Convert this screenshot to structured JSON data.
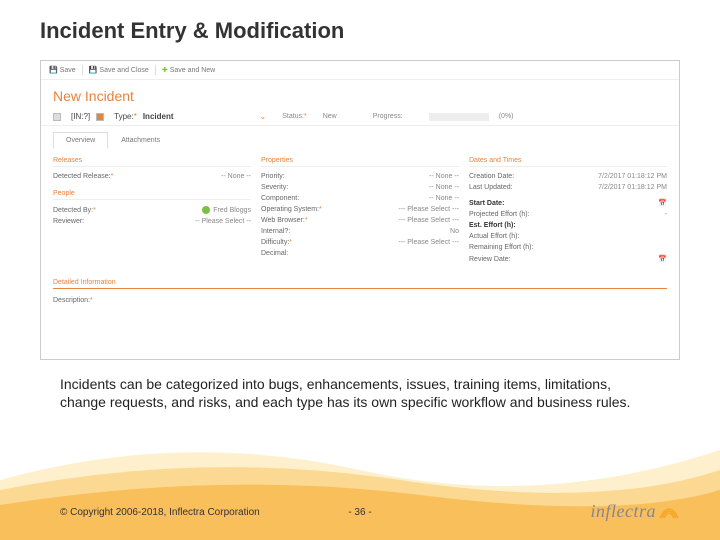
{
  "slide": {
    "title": "Incident Entry & Modification",
    "caption": "Incidents can be categorized into bugs, enhancements, issues, training items, limitations, change requests, and risks, and each type has its own specific workflow and business rules.",
    "copyright": "© Copyright 2006-2018, Inflectra Corporation",
    "page": "- 36 -",
    "logo_text": "inflectra"
  },
  "app": {
    "toolbar": {
      "save": "Save",
      "save_close": "Save and Close",
      "save_new": "Save and New"
    },
    "heading": "New Incident",
    "id_prefix": "[IN:?]",
    "type_label": "Type:",
    "type_value": "Incident",
    "status_label": "Status:",
    "status_value": "New",
    "progress_label": "Progress:",
    "progress_percent": "(0%)",
    "tabs": [
      "Overview",
      "Attachments"
    ],
    "sections": {
      "releases": {
        "title": "Releases",
        "detected_release": "Detected Release:",
        "detected_release_v": "-- None --"
      },
      "people": {
        "title": "People",
        "detected_by": "Detected By:",
        "detected_by_v": "Fred Bloggs",
        "reviewer": "Reviewer:",
        "reviewer_v": "-- Please Select --"
      },
      "properties": {
        "title": "Properties",
        "fields": [
          {
            "k": "Priority:",
            "v": "-- None --"
          },
          {
            "k": "Severity:",
            "v": "-- None --"
          },
          {
            "k": "Component:",
            "v": "-- None --"
          },
          {
            "k": "Operating System:",
            "v": "--- Please Select ---"
          },
          {
            "k": "Web Browser:",
            "v": "--- Please Select ---"
          },
          {
            "k": "Internal?:",
            "v": "No"
          },
          {
            "k": "Difficulty:",
            "v": "--- Please Select ---"
          },
          {
            "k": "Decimal:",
            "v": ""
          }
        ]
      },
      "dates": {
        "title": "Dates and Times",
        "fields": [
          {
            "k": "Creation Date:",
            "v": "7/2/2017 01:18:12 PM"
          },
          {
            "k": "Last Updated:",
            "v": "7/2/2017 01:18:12 PM"
          },
          {
            "k": "Start Date:",
            "v": ""
          },
          {
            "k": "Projected Effort (h):",
            "v": ""
          },
          {
            "k": "Est. Effort (h):",
            "v": ""
          },
          {
            "k": "Actual Effort (h):",
            "v": ""
          },
          {
            "k": "Remaining Effort (h):",
            "v": ""
          },
          {
            "k": "Review Date:",
            "v": ""
          }
        ]
      },
      "detailed": {
        "title": "Detailed Information",
        "description": "Description:"
      }
    }
  }
}
